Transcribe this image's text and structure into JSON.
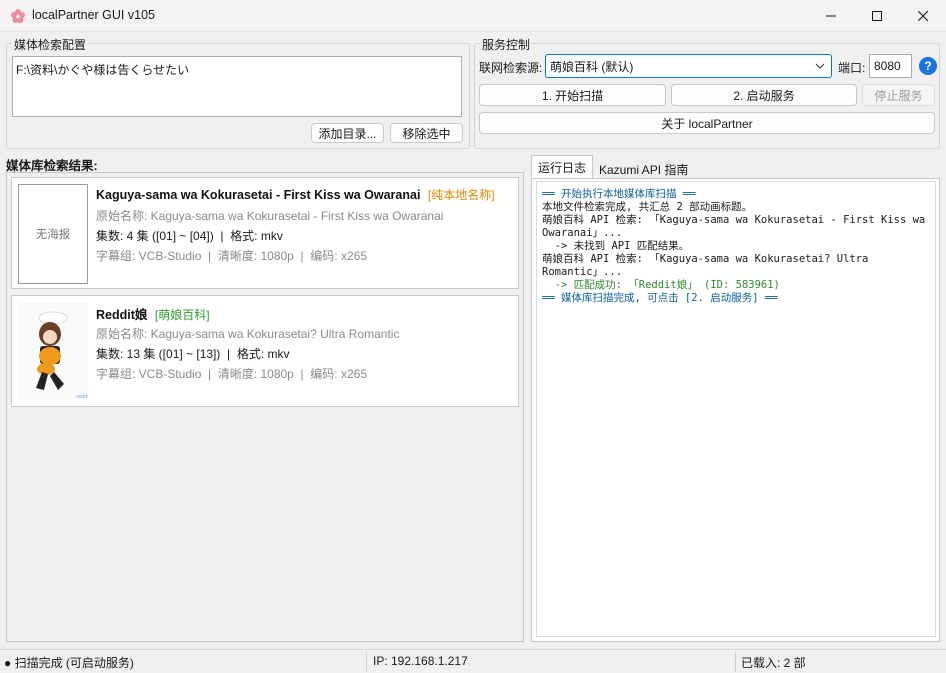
{
  "window": {
    "title": "localPartner GUI v105",
    "controls": {
      "minimize": "minimize-icon",
      "maximize": "maximize-icon",
      "close": "close-icon"
    }
  },
  "media_config": {
    "group_label": "媒体检索配置",
    "path_text": "F:\\资料\\かぐや様は告くらせたい",
    "add_button": "添加目录...",
    "remove_button": "移除选中"
  },
  "service": {
    "group_label": "服务控制",
    "source_label": "联网检索源:",
    "source_selected": "萌娘百科 (默认)",
    "port_label": "端口:",
    "port_value": "8080",
    "help_icon": "?",
    "scan_button": "1. 开始扫描",
    "start_button": "2. 启动服务",
    "stop_button": "停止服务",
    "about_button": "关于 localPartner"
  },
  "results": {
    "heading": "媒体库检索结果:",
    "items": [
      {
        "poster_text": "无海报",
        "title": "Kaguya-sama wa Kokurasetai - First Kiss wa Owaranai",
        "tag": "[纯本地名称]",
        "original": "原始名称: Kaguya-sama wa Kokurasetai - First Kiss wa Owaranai",
        "episodes": "集数: 4 集 ([01] ~ [04])  |  格式: mkv",
        "info": "字幕组: VCB-Studio  |  清晰度: 1080p  |  编码: x265"
      },
      {
        "poster_text": "",
        "title": "Reddit娘",
        "tag": "[萌娘百科]",
        "original": "原始名称: Kaguya-sama wa Kokurasetai? Ultra Romantic",
        "episodes": "集数: 13 集 ([01] ~ [13])  |  格式: mkv",
        "info": "字幕组: VCB-Studio  |  清晰度: 1080p  |  编码: x265"
      }
    ]
  },
  "tabs": [
    "运行日志",
    "Kazumi API 指南"
  ],
  "log": [
    {
      "text": "══ 开始执行本地媒体库扫描 ══",
      "color": "blue"
    },
    {
      "text": "本地文件检索完成, 共汇总 2 部动画标题。",
      "color": "dark"
    },
    {
      "text": "萌娘百科 API 检索: 「Kaguya-sama wa Kokurasetai - First Kiss wa Owaranai」...",
      "color": "dark"
    },
    {
      "text": "  -> 未找到 API 匹配结果。",
      "color": "dark"
    },
    {
      "text": "萌娘百科 API 检索: 「Kaguya-sama wa Kokurasetai? Ultra Romantic」...",
      "color": "dark"
    },
    {
      "text": "  -> 匹配成功: 「Reddit娘」 (ID: 583961)",
      "color": "green"
    },
    {
      "text": "══ 媒体库扫描完成, 可点击 [2. 启动服务] ══",
      "color": "blue"
    }
  ],
  "statusbar": {
    "status": "● 扫描完成 (可启动服务)",
    "ip": "IP: 192.168.1.217",
    "loaded": "已载入: 2 部"
  },
  "colors": {
    "accent": "#0a5ea8",
    "help": "#1a73e8",
    "tag_local": "#e08a00",
    "tag_moe": "#2e9a2e"
  }
}
